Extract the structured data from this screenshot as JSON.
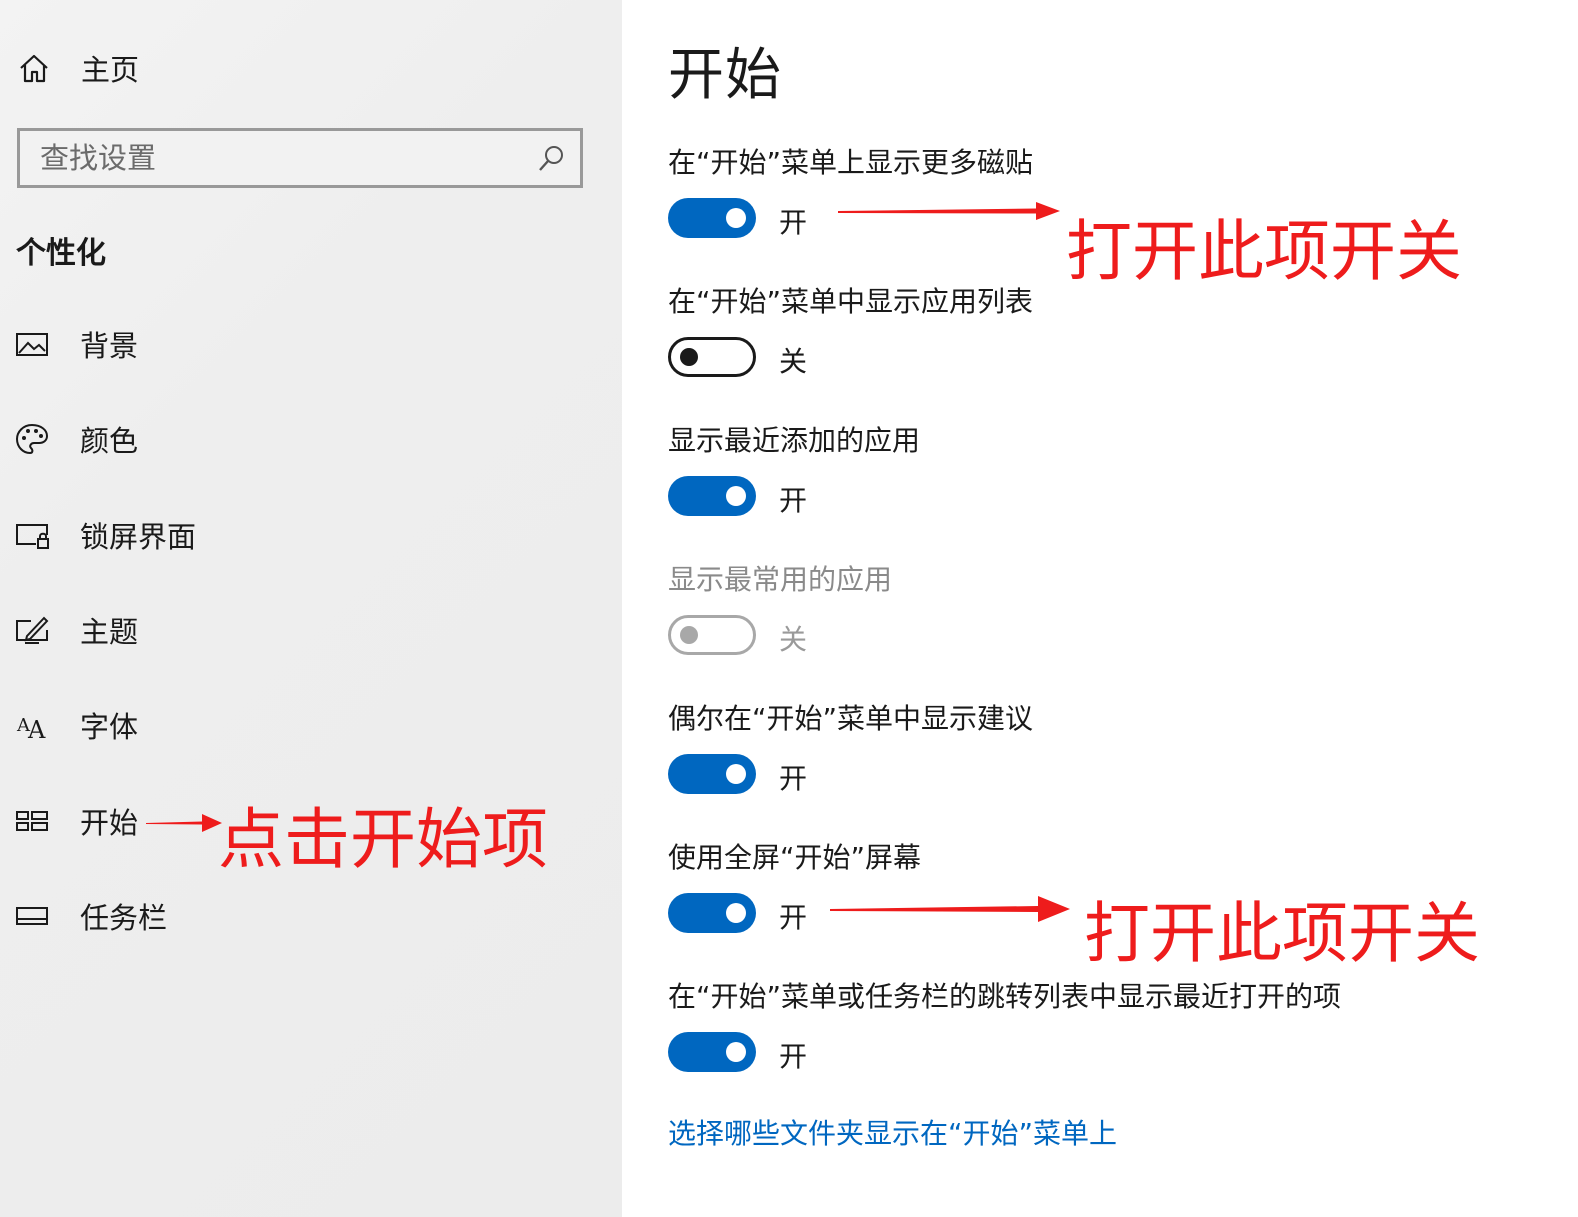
{
  "sidebar": {
    "home_label": "主页",
    "search_placeholder": "查找设置",
    "section_title": "个性化",
    "items": [
      {
        "label": "背景",
        "icon": "picture-icon"
      },
      {
        "label": "颜色",
        "icon": "palette-icon"
      },
      {
        "label": "锁屏界面",
        "icon": "lock-screen-icon"
      },
      {
        "label": "主题",
        "icon": "theme-icon"
      },
      {
        "label": "字体",
        "icon": "font-icon"
      },
      {
        "label": "开始",
        "icon": "start-icon"
      },
      {
        "label": "任务栏",
        "icon": "taskbar-icon"
      }
    ]
  },
  "main": {
    "title": "开始",
    "settings": [
      {
        "label": "在“开始”菜单上显示更多磁贴",
        "state": "on",
        "state_text": "开"
      },
      {
        "label": "在“开始”菜单中显示应用列表",
        "state": "off",
        "state_text": "关"
      },
      {
        "label": "显示最近添加的应用",
        "state": "on",
        "state_text": "开"
      },
      {
        "label": "显示最常用的应用",
        "state": "disabled",
        "state_text": "关"
      },
      {
        "label": "偶尔在“开始”菜单中显示建议",
        "state": "on",
        "state_text": "开"
      },
      {
        "label": "使用全屏“开始”屏幕",
        "state": "on",
        "state_text": "开"
      },
      {
        "label": "在“开始”菜单或任务栏的跳转列表中显示最近打开的项",
        "state": "on",
        "state_text": "开"
      }
    ],
    "folders_link": "选择哪些文件夹显示在“开始”菜单上"
  },
  "annotations": {
    "sidebar_note": "点击开始项",
    "toggle_note_1": "打开此项开关",
    "toggle_note_2": "打开此项开关",
    "color": "#ee1c1c"
  },
  "colors": {
    "accent": "#0067c0",
    "sidebar_bg": "#eeeeee",
    "annotation": "#ee1c1c"
  }
}
